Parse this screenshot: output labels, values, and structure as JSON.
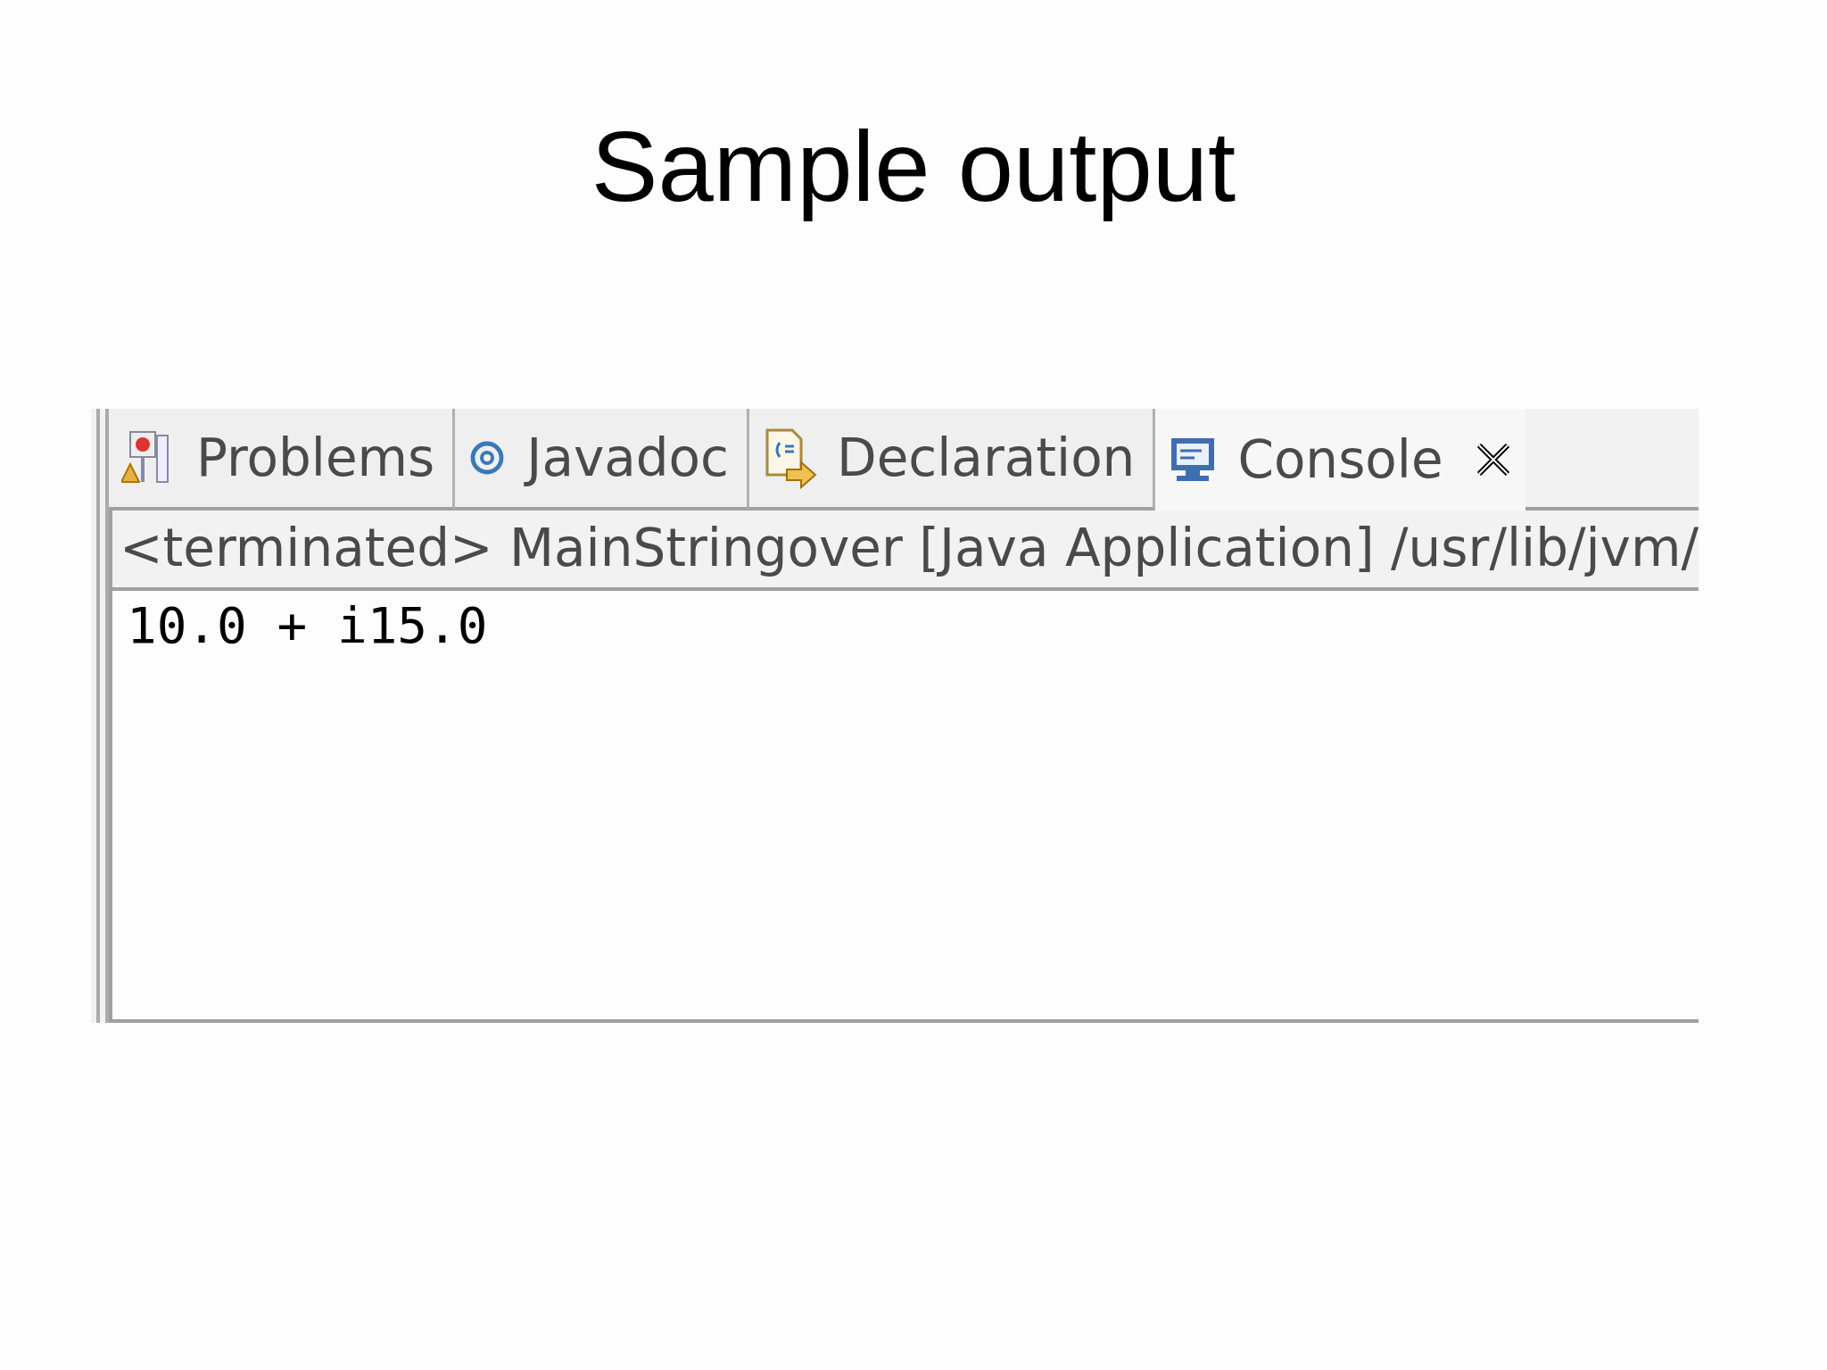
{
  "slide": {
    "title": "Sample output"
  },
  "tabs": [
    {
      "label": "Problems",
      "kind": "problems",
      "selected": false
    },
    {
      "label": "Javadoc",
      "kind": "javadoc",
      "selected": false
    },
    {
      "label": "Declaration",
      "kind": "declaration",
      "selected": false
    },
    {
      "label": "Console",
      "kind": "console",
      "selected": true
    }
  ],
  "console": {
    "status": "<terminated> MainStringover [Java Application] /usr/lib/jvm/",
    "output": [
      "10.0 + i15.0"
    ]
  }
}
